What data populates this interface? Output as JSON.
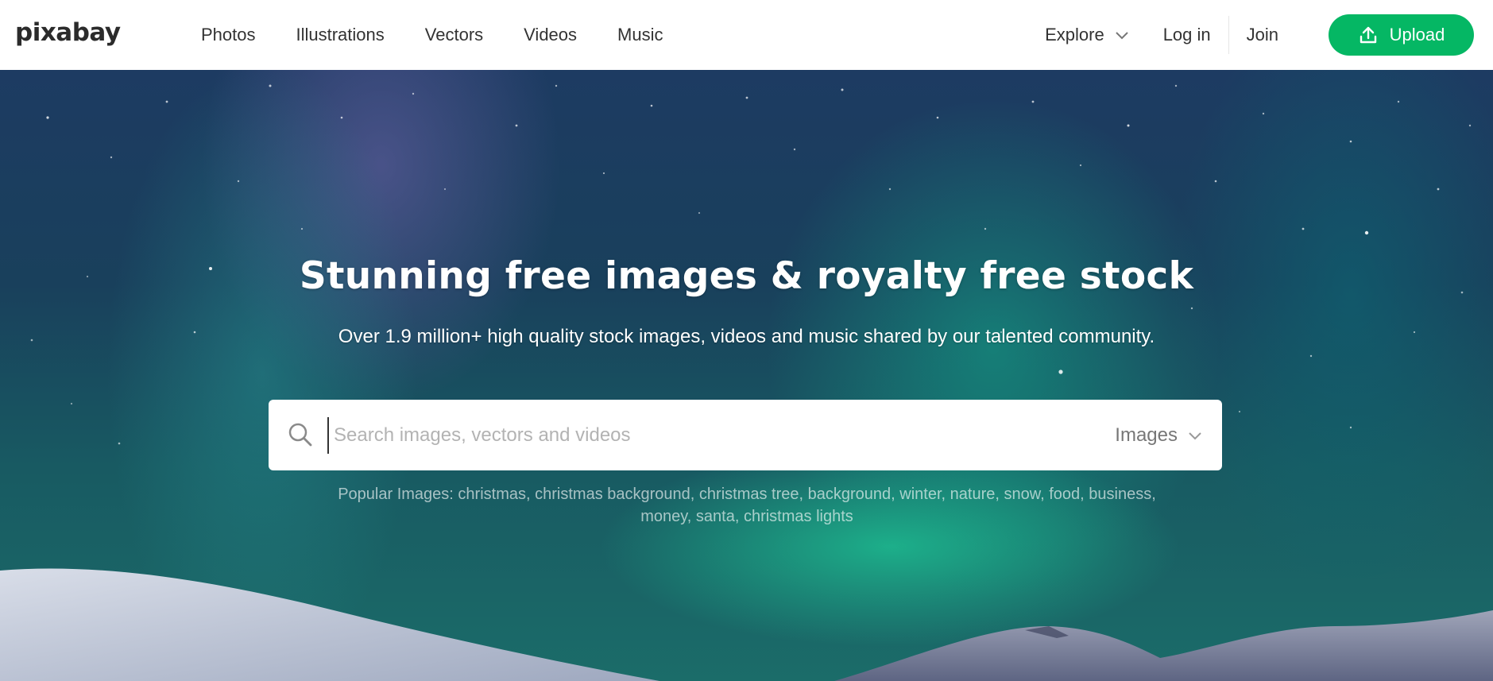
{
  "brand": {
    "logo_text": "pixabay",
    "accent_color": "#05b764"
  },
  "nav": {
    "items": [
      {
        "label": "Photos"
      },
      {
        "label": "Illustrations"
      },
      {
        "label": "Vectors"
      },
      {
        "label": "Videos"
      },
      {
        "label": "Music"
      }
    ]
  },
  "right_nav": {
    "explore_label": "Explore",
    "login_label": "Log in",
    "join_label": "Join",
    "upload_label": "Upload"
  },
  "hero": {
    "title": "Stunning free images & royalty free stock",
    "subtitle": "Over 1.9 million+ high quality stock images, videos and music shared by our talented community."
  },
  "search": {
    "placeholder": "Search images, vectors and videos",
    "value": "",
    "type_selected": "Images"
  },
  "popular": {
    "prefix": "Popular Images:",
    "tags": [
      "christmas",
      "christmas background",
      "christmas tree",
      "background",
      "winter",
      "nature",
      "snow",
      "food",
      "business",
      "money",
      "santa",
      "christmas lights"
    ]
  },
  "icons": {
    "explore": "chevron-down-icon",
    "upload": "upload-icon",
    "search": "search-icon",
    "type_select": "chevron-down-icon"
  }
}
